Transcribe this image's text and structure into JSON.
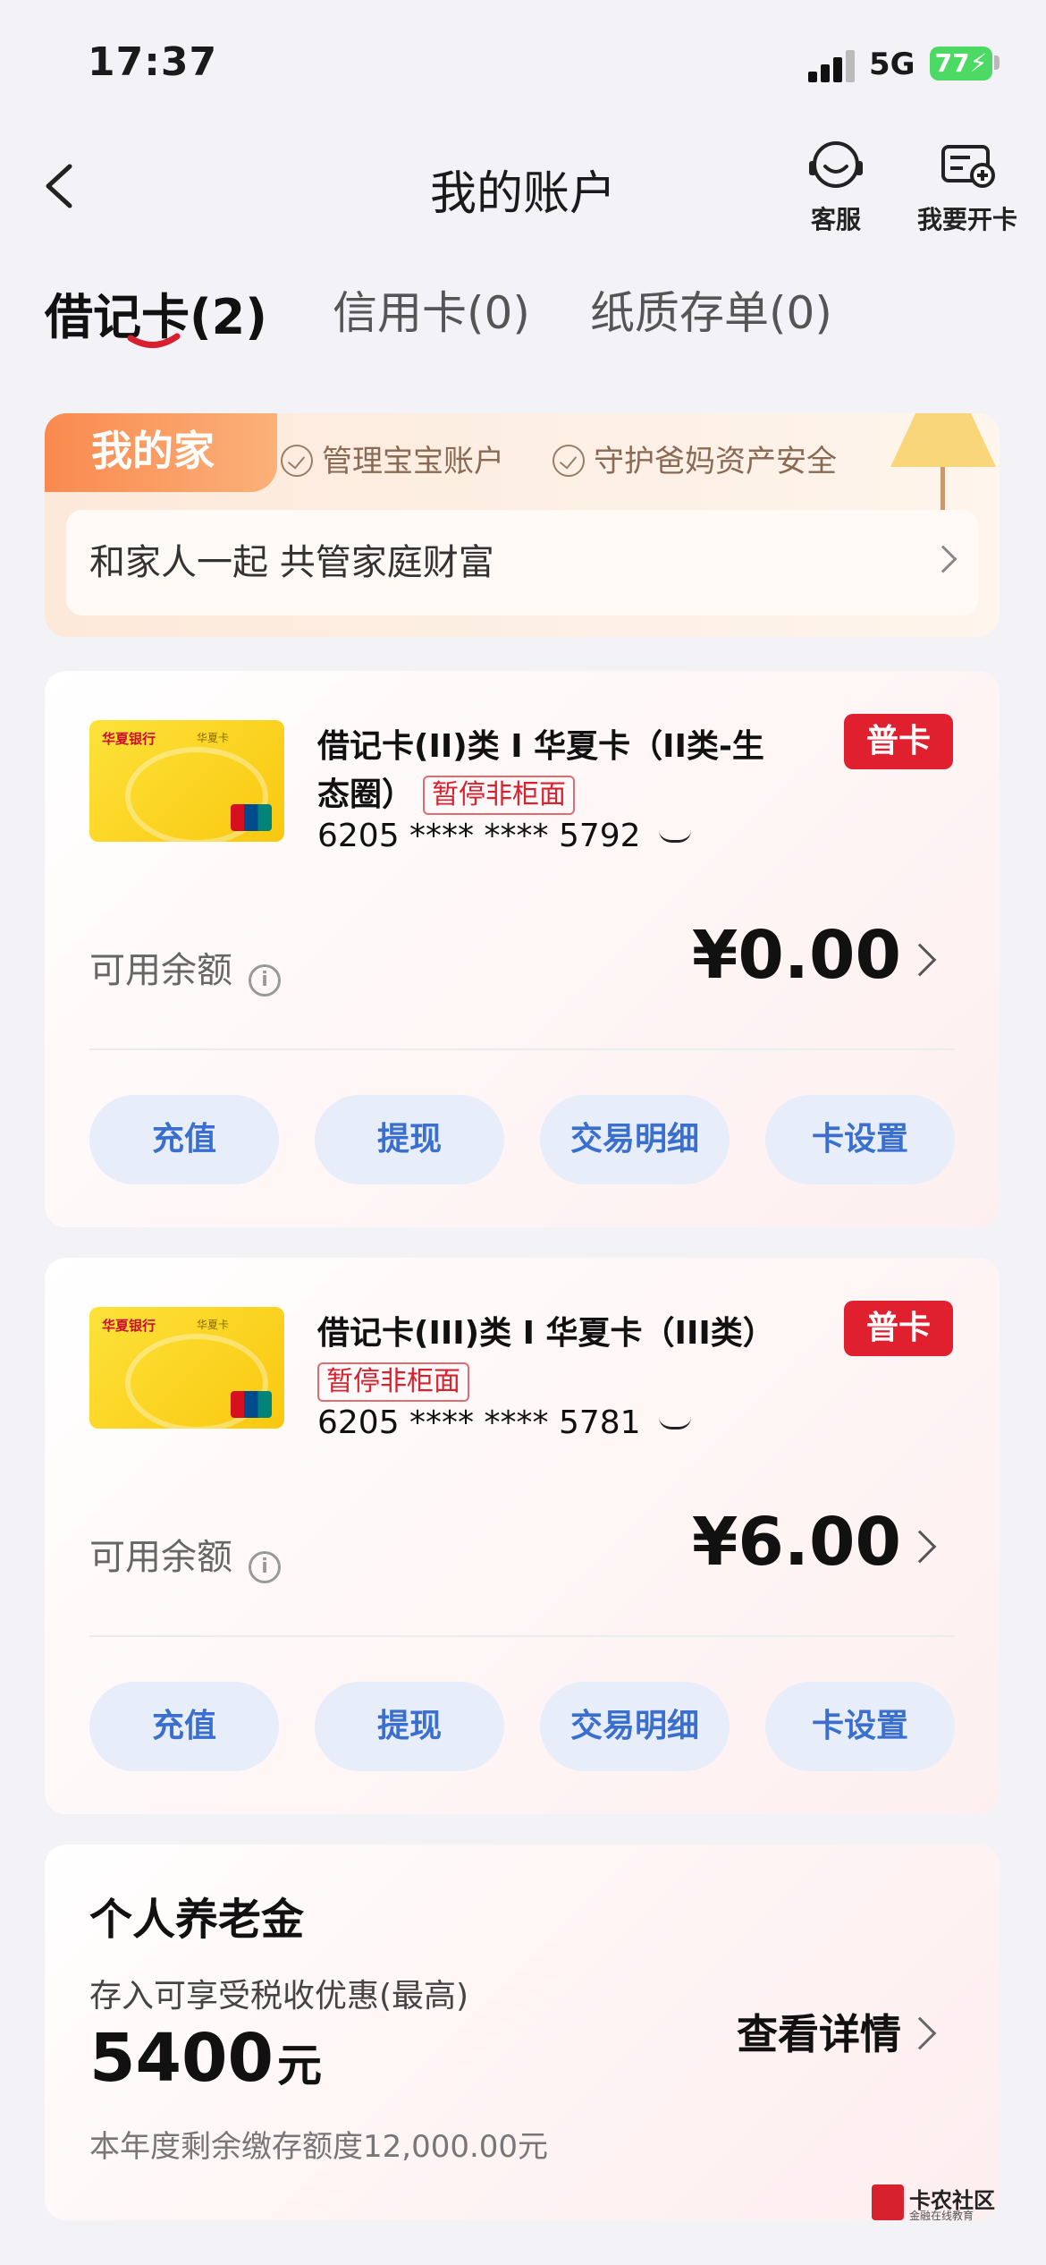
{
  "status": {
    "time": "17:37",
    "network": "5G",
    "battery": "77"
  },
  "nav": {
    "title": "我的账户",
    "service_label": "客服",
    "open_card_label": "我要开卡"
  },
  "tabs": [
    {
      "label": "借记卡(2)",
      "active": true
    },
    {
      "label": "信用卡(0)",
      "active": false
    },
    {
      "label": "纸质存单(0)",
      "active": false
    }
  ],
  "family": {
    "tag": "我的家",
    "features": [
      "管理宝宝账户",
      "守护爸妈资产安全"
    ],
    "row_text": "和家人一起 共管家庭财富"
  },
  "cards": [
    {
      "bank_logo": "华夏银行",
      "card_sub": "华夏卡",
      "name_line1": "借记卡(II)类 I 华夏卡（II类-生",
      "name_line2": "态圈）",
      "suspend": "暂停非柜面",
      "number": "6205 **** **** 5792",
      "badge": "普卡",
      "balance_label": "可用余额",
      "balance": "¥0.00",
      "actions": [
        "充值",
        "提现",
        "交易明细",
        "卡设置"
      ]
    },
    {
      "bank_logo": "华夏银行",
      "card_sub": "华夏卡",
      "name_line1": "借记卡(III)类 I 华夏卡（III类）",
      "suspend": "暂停非柜面",
      "number": "6205 **** **** 5781",
      "badge": "普卡",
      "balance_label": "可用余额",
      "balance": "¥6.00",
      "actions": [
        "充值",
        "提现",
        "交易明细",
        "卡设置"
      ]
    }
  ],
  "pension": {
    "title": "个人养老金",
    "subtitle": "存入可享受税收优惠(最高)",
    "amount": "5400",
    "unit": "元",
    "note": "本年度剩余缴存额度12,000.00元",
    "detail_label": "查看详情"
  },
  "watermark": {
    "name": "卡农社区",
    "sub": "金融在线教育"
  },
  "colors": {
    "accent_red": "#e0202f",
    "action_blue": "#3a6fcf",
    "family_orange": "#f98a4f"
  }
}
